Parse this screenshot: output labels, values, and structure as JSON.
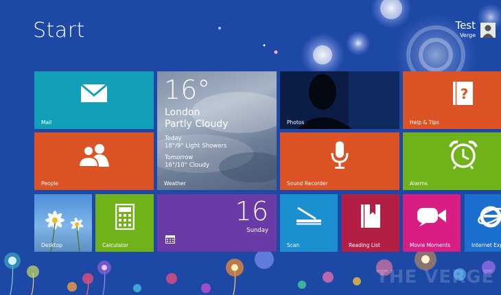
{
  "screen": {
    "title": "Start"
  },
  "user": {
    "name": "Test",
    "subtitle": "Verge"
  },
  "watermark": "THE VERGE",
  "colors": {
    "background": "#1e48a6",
    "teal": "#12a0b8",
    "orange": "#dc5326",
    "green": "#6fb21a",
    "purple": "#6a3aa6",
    "crimson": "#b31e45",
    "magenta": "#d81d84",
    "blue": "#1b6fcf",
    "photos": "#0b1a3e"
  },
  "tiles": {
    "mail": {
      "label": "Mail",
      "icon": "mail-envelope-icon"
    },
    "weather": {
      "label": "Weather",
      "temp": "16°",
      "city": "London",
      "condition": "Partly Cloudy",
      "today_label": "Today",
      "today_forecast": "18°/9° Light Showers",
      "tomorrow_label": "Tomorrow",
      "tomorrow_forecast": "16°/10° Cloudy"
    },
    "photos": {
      "label": "Photos"
    },
    "help": {
      "label": "Help & Tips",
      "icon": "help-book-icon"
    },
    "people": {
      "label": "People",
      "icon": "people-icon"
    },
    "sound_recorder": {
      "label": "Sound Recorder",
      "icon": "microphone-icon"
    },
    "alarms": {
      "label": "Alarms",
      "icon": "alarm-clock-icon"
    },
    "desktop": {
      "label": "Desktop"
    },
    "calculator": {
      "label": "Calculator",
      "icon": "calculator-icon"
    },
    "calendar": {
      "day": "16",
      "weekday": "Sunday",
      "icon": "calendar-icon"
    },
    "scan": {
      "label": "Scan",
      "icon": "scanner-icon"
    },
    "reading_list": {
      "label": "Reading List",
      "icon": "bookmark-book-icon"
    },
    "movie_moments": {
      "label": "Movie Moments",
      "icon": "video-camera-icon"
    },
    "internet_explorer": {
      "label": "Internet Explore",
      "icon": "internet-explorer-icon"
    }
  }
}
